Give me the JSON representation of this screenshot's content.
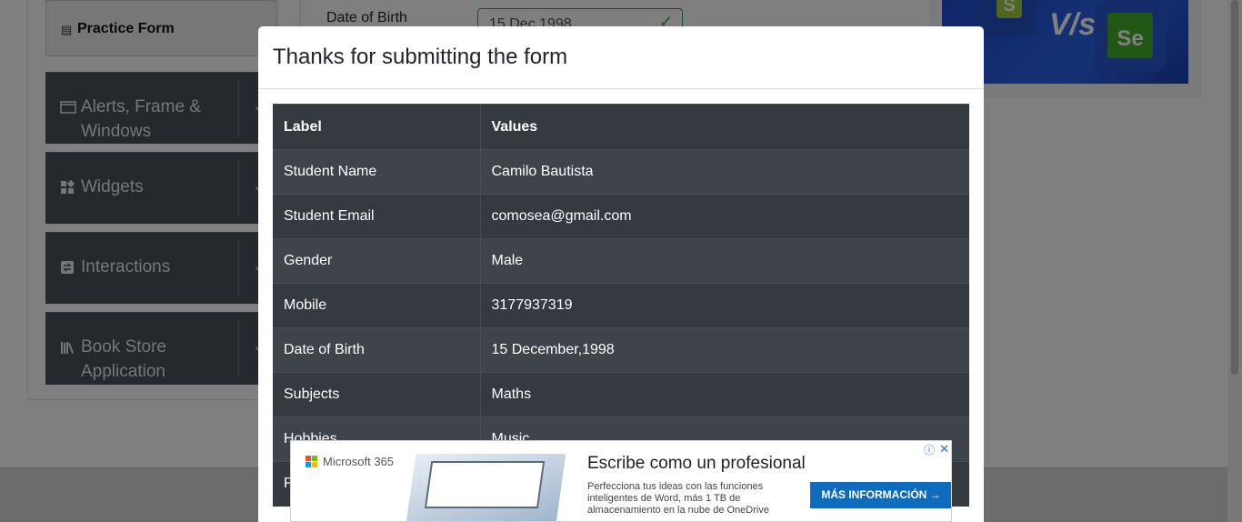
{
  "sidebar": {
    "active_item": {
      "label": "Practice Form",
      "icon": "form-icon"
    },
    "groups": [
      {
        "label": "Alerts, Frame & Windows",
        "icon": "window-icon"
      },
      {
        "label": "Widgets",
        "icon": "widgets-icon"
      },
      {
        "label": "Interactions",
        "icon": "interactions-icon"
      },
      {
        "label": "Book Store Application",
        "icon": "books-icon"
      }
    ]
  },
  "form_background": {
    "dob_label": "Date of Birth",
    "dob_value": "15 Dec 1998"
  },
  "modal": {
    "title": "Thanks for submitting the form",
    "headers": {
      "label": "Label",
      "values": "Values"
    },
    "rows": [
      {
        "label": "Student Name",
        "value": "Camilo Bautista"
      },
      {
        "label": "Student Email",
        "value": "comosea@gmail.com"
      },
      {
        "label": "Gender",
        "value": "Male"
      },
      {
        "label": "Mobile",
        "value": "3177937319"
      },
      {
        "label": "Date of Birth",
        "value": "15 December,1998"
      },
      {
        "label": "Subjects",
        "value": "Maths"
      },
      {
        "label": "Hobbies",
        "value": "Music"
      },
      {
        "label": "P",
        "value": ""
      }
    ]
  },
  "ad": {
    "brand": "Microsoft 365",
    "headline": "Escribe como un profesional",
    "body": "Perfecciona tus ideas con las funciones inteligentes de Word, más 1 TB de almacenamiento en la nube de OneDrive",
    "cta": "MÁS INFORMACIÓN →",
    "info_icon": "ⓘ",
    "close_icon": "✕"
  },
  "colors": {
    "table_bg": "#343a40",
    "overlay": "rgba(0,0,0,0.5)",
    "cta_blue": "#0f6cbd",
    "valid_green": "#28a745"
  }
}
